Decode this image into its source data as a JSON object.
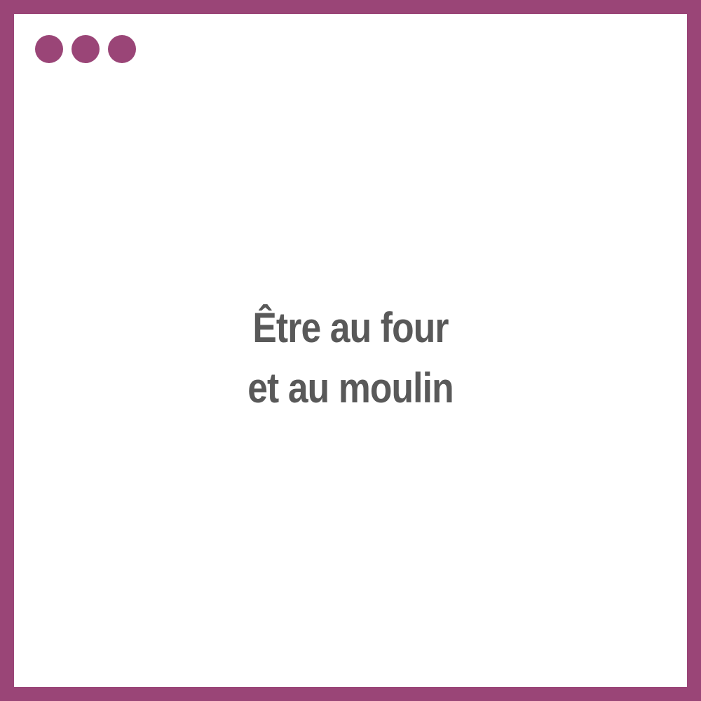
{
  "window": {
    "controls": [
      {
        "name": "control-dot-1",
        "icon": "circle-dot",
        "color": "#9a4577"
      },
      {
        "name": "control-dot-2",
        "icon": "circle-dot",
        "color": "#9a4577"
      },
      {
        "name": "control-dot-3",
        "icon": "circle-dot",
        "color": "#9a4577"
      }
    ],
    "frame_color": "#9a4577",
    "background_color": "#ffffff"
  },
  "main": {
    "title_line_1": "Être au four",
    "title_line_2": "et au moulin",
    "text_color": "#595959"
  }
}
